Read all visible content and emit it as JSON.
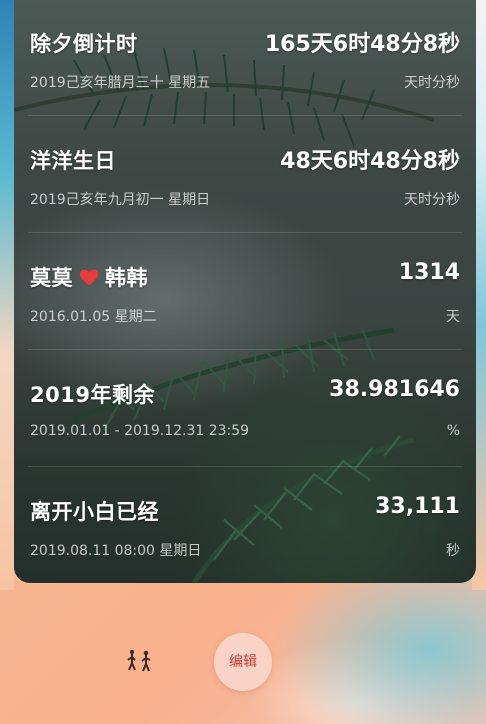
{
  "rows": [
    {
      "title": "除夕倒计时",
      "value": "165天6时48分8秒",
      "sub": "2019己亥年腊月三十  星期五",
      "unit": "天时分秒"
    },
    {
      "title": "洋洋生日",
      "value": "48天6时48分8秒",
      "sub": "2019己亥年九月初一  星期日",
      "unit": "天时分秒"
    },
    {
      "title_left": "莫莫",
      "title_right": "韩韩",
      "value": "1314",
      "sub": "2016.01.05  星期二",
      "unit": "天"
    },
    {
      "title": "2019年剩余",
      "value": "38.981646",
      "sub": "2019.01.01  - 2019.12.31 23:59",
      "unit": "%"
    },
    {
      "title": "离开小白已经",
      "value": "33,111",
      "sub": "2019.08.11 08:00  星期日",
      "unit": "秒"
    }
  ],
  "edit_label": "编辑",
  "colors": {
    "heart": "#e83b3b",
    "edit_text": "#c9423a",
    "edit_bg": "#f8d3c6"
  }
}
